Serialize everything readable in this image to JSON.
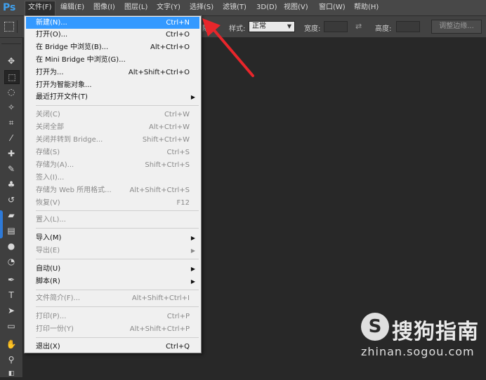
{
  "app": {
    "logo": "Ps"
  },
  "menubar": {
    "items": [
      {
        "label": "文件(F)"
      },
      {
        "label": "编辑(E)"
      },
      {
        "label": "图像(I)"
      },
      {
        "label": "图层(L)"
      },
      {
        "label": "文字(Y)"
      },
      {
        "label": "选择(S)"
      },
      {
        "label": "滤镜(T)"
      },
      {
        "label": "3D(D)"
      },
      {
        "label": "视图(V)"
      },
      {
        "label": "窗口(W)"
      },
      {
        "label": "帮助(H)"
      }
    ]
  },
  "options": {
    "partial_label": "除",
    "style_label": "样式:",
    "style_value": "正常",
    "width_label": "宽度:",
    "height_label": "高度:",
    "refine_button": "调整边缘..."
  },
  "file_menu": {
    "items": [
      {
        "label": "新建(N)...",
        "shortcut": "Ctrl+N",
        "state": "highlight"
      },
      {
        "label": "打开(O)...",
        "shortcut": "Ctrl+O"
      },
      {
        "label": "在 Bridge 中浏览(B)...",
        "shortcut": "Alt+Ctrl+O"
      },
      {
        "label": "在 Mini Bridge 中浏览(G)...",
        "shortcut": ""
      },
      {
        "label": "打开为...",
        "shortcut": "Alt+Shift+Ctrl+O"
      },
      {
        "label": "打开为智能对象...",
        "shortcut": ""
      },
      {
        "label": "最近打开文件(T)",
        "shortcut": "",
        "submenu": true
      },
      {
        "label": "关闭(C)",
        "shortcut": "Ctrl+W",
        "disabled": true
      },
      {
        "label": "关闭全部",
        "shortcut": "Alt+Ctrl+W",
        "disabled": true
      },
      {
        "label": "关闭并转到 Bridge...",
        "shortcut": "Shift+Ctrl+W",
        "disabled": true
      },
      {
        "label": "存储(S)",
        "shortcut": "Ctrl+S",
        "disabled": true
      },
      {
        "label": "存储为(A)...",
        "shortcut": "Shift+Ctrl+S",
        "disabled": true
      },
      {
        "label": "签入(I)...",
        "shortcut": "",
        "disabled": true
      },
      {
        "label": "存储为 Web 所用格式...",
        "shortcut": "Alt+Shift+Ctrl+S",
        "disabled": true
      },
      {
        "label": "恢复(V)",
        "shortcut": "F12",
        "disabled": true
      },
      {
        "label": "置入(L)...",
        "shortcut": "",
        "disabled": true
      },
      {
        "label": "导入(M)",
        "shortcut": "",
        "submenu": true
      },
      {
        "label": "导出(E)",
        "shortcut": "",
        "submenu": true,
        "disabled": true
      },
      {
        "label": "自动(U)",
        "shortcut": "",
        "submenu": true
      },
      {
        "label": "脚本(R)",
        "shortcut": "",
        "submenu": true
      },
      {
        "label": "文件简介(F)...",
        "shortcut": "Alt+Shift+Ctrl+I",
        "disabled": true
      },
      {
        "label": "打印(P)...",
        "shortcut": "Ctrl+P",
        "disabled": true
      },
      {
        "label": "打印一份(Y)",
        "shortcut": "Alt+Shift+Ctrl+P",
        "disabled": true
      },
      {
        "label": "退出(X)",
        "shortcut": "Ctrl+Q"
      }
    ]
  },
  "watermark": {
    "logo": "S",
    "title": "搜狗指南",
    "url": "zhinan.sogou.com"
  },
  "colors": {
    "highlight": "#3399ff",
    "annotation_arrow": "#e8262b",
    "ps_blue": "#3fa0ee"
  }
}
